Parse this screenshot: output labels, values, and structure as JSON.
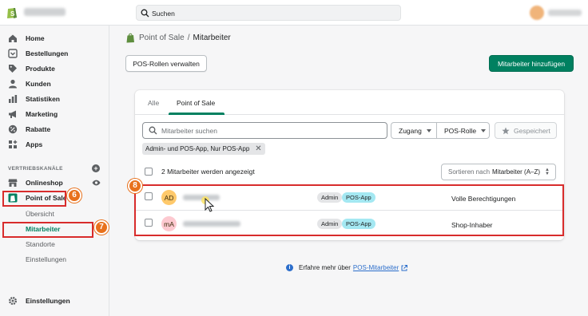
{
  "topbar": {
    "search_placeholder": "Suchen"
  },
  "sidebar": {
    "items": [
      {
        "label": "Home",
        "icon": "home-icon"
      },
      {
        "label": "Bestellungen",
        "icon": "orders-icon"
      },
      {
        "label": "Produkte",
        "icon": "tag-icon"
      },
      {
        "label": "Kunden",
        "icon": "person-icon"
      },
      {
        "label": "Statistiken",
        "icon": "bar-chart-icon"
      },
      {
        "label": "Marketing",
        "icon": "megaphone-icon"
      },
      {
        "label": "Rabatte",
        "icon": "discount-icon"
      },
      {
        "label": "Apps",
        "icon": "apps-icon"
      }
    ],
    "sales_channels_title": "VERTRIEBSKANÄLE",
    "channels": [
      {
        "label": "Onlineshop",
        "icon": "store-icon"
      },
      {
        "label": "Point of Sale",
        "icon": "pos-icon"
      }
    ],
    "sub_items": [
      "Übersicht",
      "Mitarbeiter",
      "Standorte",
      "Einstellungen"
    ],
    "settings_label": "Einstellungen"
  },
  "breadcrumb": {
    "parent": "Point of Sale",
    "separator": "/",
    "current": "Mitarbeiter"
  },
  "actions": {
    "manage_roles": "POS-Rollen verwalten",
    "add_staff": "Mitarbeiter hinzufügen"
  },
  "tabs": [
    "Alle",
    "Point of Sale"
  ],
  "filters": {
    "search_placeholder": "Mitarbeiter suchen",
    "access": "Zugang",
    "pos_role": "POS-Rolle",
    "saved": "Gespeichert",
    "applied_tag": "Admin- und POS-App, Nur POS-App"
  },
  "list": {
    "count_label": "2 Mitarbeiter werden angezeigt",
    "sort_prefix": "Sortieren nach",
    "sort_value": "Mitarbeiter (A–Z)",
    "rows": [
      {
        "initials": "AD",
        "avatar_color": "#ffc96b",
        "badges": [
          "Admin",
          "POS-App"
        ],
        "permission": "Volle Berechtigungen"
      },
      {
        "initials": "mA",
        "avatar_color": "#fdc9d0",
        "badges": [
          "Admin",
          "POS-App"
        ],
        "permission": "Shop-Inhaber"
      }
    ]
  },
  "footer": {
    "learn_text": "Erfahre mehr über",
    "learn_link": "POS-Mitarbeiter"
  },
  "steps": [
    "6",
    "7",
    "8"
  ],
  "colors": {
    "primary": "#008060",
    "highlight": "#d82c2c",
    "step_badge": "#e8711c",
    "pos_badge": "#a4e8f2"
  }
}
